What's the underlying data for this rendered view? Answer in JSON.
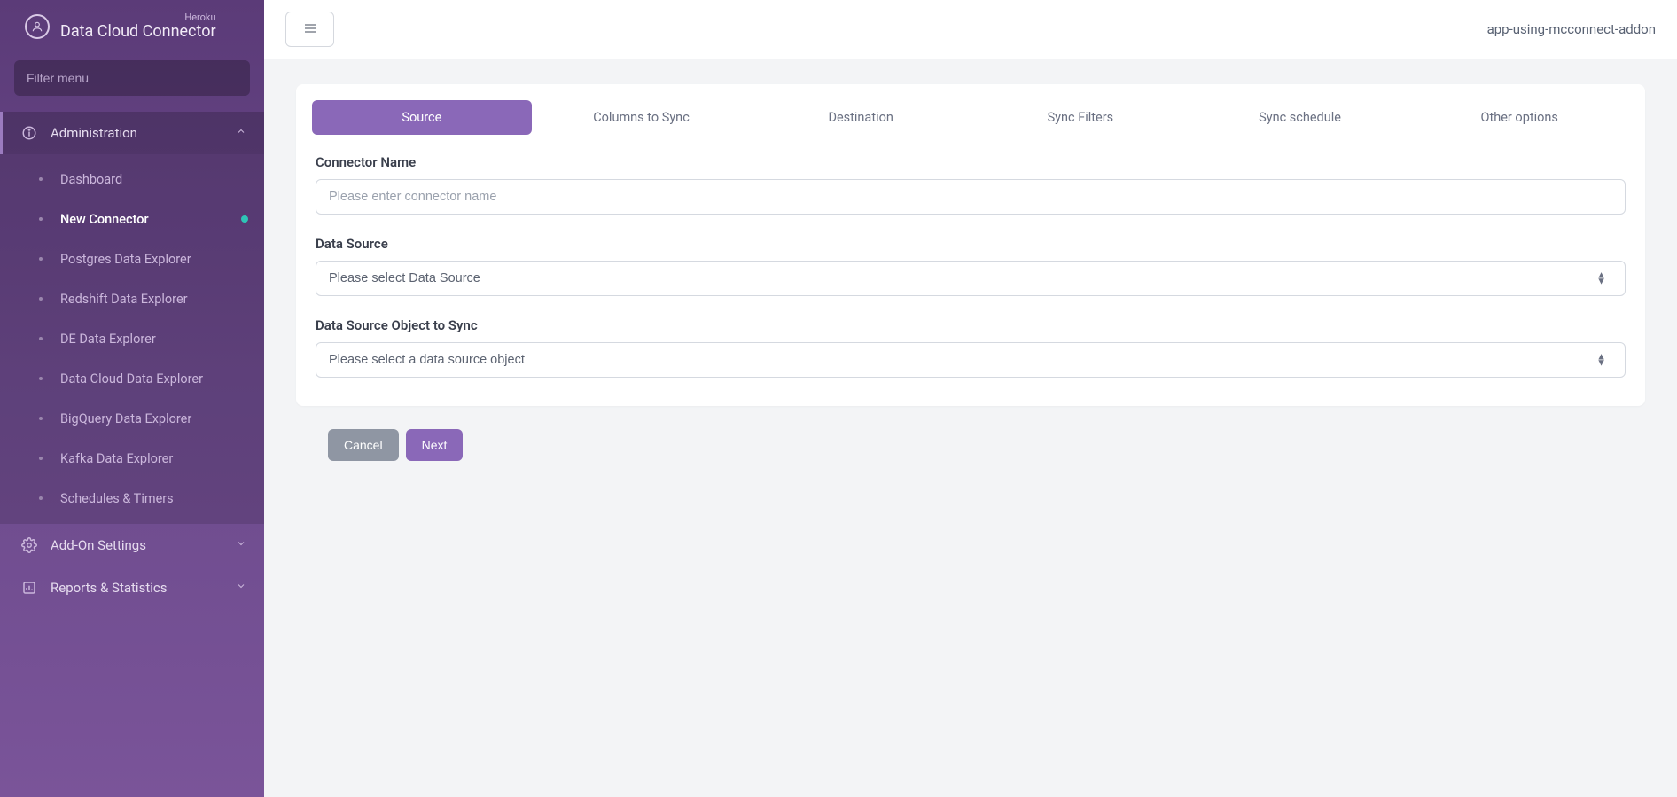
{
  "brand": {
    "sub": "Heroku",
    "title": "Data Cloud Connector"
  },
  "sidebar": {
    "filter_placeholder": "Filter menu",
    "sections": [
      {
        "label": "Administration",
        "expanded": true
      },
      {
        "label": "Add-On Settings",
        "expanded": false
      },
      {
        "label": "Reports & Statistics",
        "expanded": false
      }
    ],
    "admin_items": [
      {
        "label": "Dashboard"
      },
      {
        "label": "New Connector",
        "active": true,
        "indicator": true
      },
      {
        "label": "Postgres Data Explorer"
      },
      {
        "label": "Redshift Data Explorer"
      },
      {
        "label": "DE Data Explorer"
      },
      {
        "label": "Data Cloud Data Explorer"
      },
      {
        "label": "BigQuery Data Explorer"
      },
      {
        "label": "Kafka Data Explorer"
      },
      {
        "label": "Schedules & Timers"
      }
    ]
  },
  "topbar": {
    "app_name": "app-using-mcconnect-addon"
  },
  "wizard": {
    "tabs": [
      "Source",
      "Columns to Sync",
      "Destination",
      "Sync Filters",
      "Sync schedule",
      "Other options"
    ],
    "fields": {
      "connector_name_label": "Connector Name",
      "connector_name_placeholder": "Please enter connector name",
      "data_source_label": "Data Source",
      "data_source_placeholder": "Please select Data Source",
      "object_label": "Data Source Object to Sync",
      "object_placeholder": "Please select a data source object"
    },
    "buttons": {
      "cancel": "Cancel",
      "next": "Next"
    }
  }
}
